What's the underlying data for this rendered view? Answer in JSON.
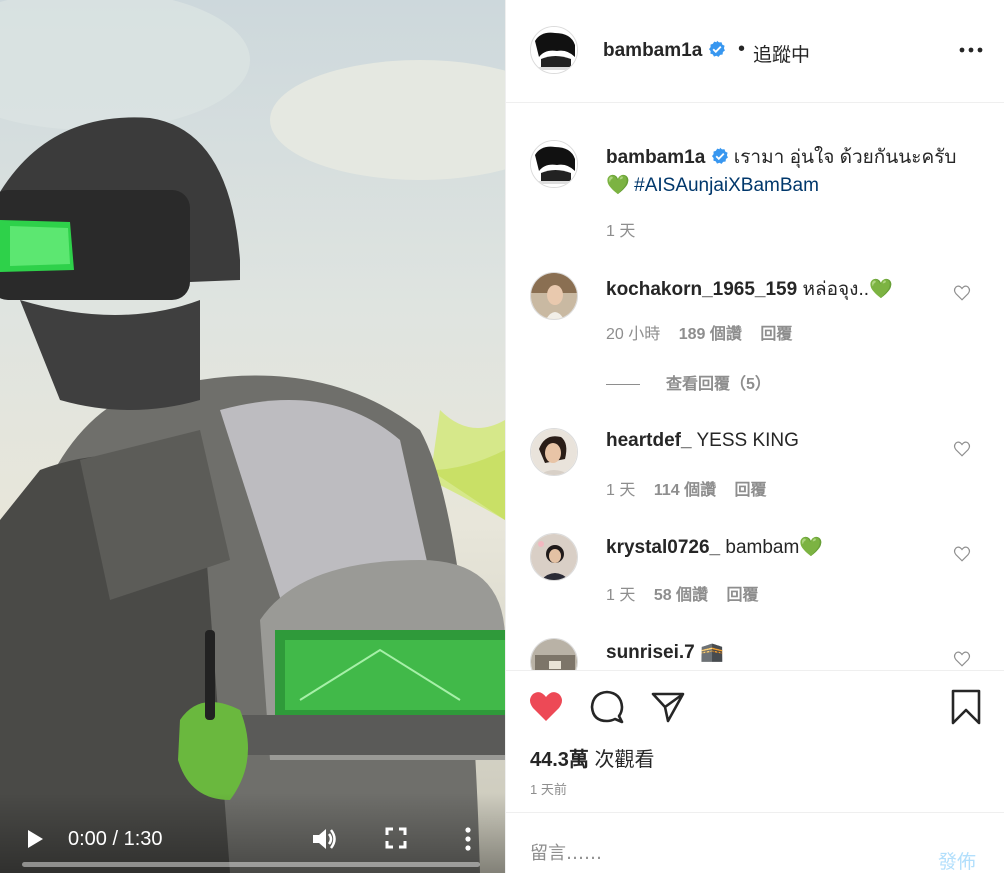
{
  "video": {
    "time_display": "0:00 / 1:30",
    "progress_fraction": 0.0
  },
  "post": {
    "author": "bambam1a",
    "follow_status": "追蹤中",
    "caption_text": "เรามา อุ่นใจ ด้วยกันนะครับ",
    "caption_emoji": "💚",
    "hashtag": "#AISAunjaiXBamBam",
    "caption_time": "1 天",
    "views_count": "44.3萬",
    "views_suffix": "次觀看",
    "posted_ago": "1 天前"
  },
  "comments": [
    {
      "user": "kochakorn_1965_159",
      "text": "หล่อจุง..💚",
      "time": "20 小時",
      "likes": "189 個讚",
      "reply": "回覆",
      "view_replies": "查看回覆（5）"
    },
    {
      "user": "heartdef_",
      "text": "YESS KING",
      "time": "1 天",
      "likes": "114 個讚",
      "reply": "回覆"
    },
    {
      "user": "krystal0726_",
      "text": "bambam💚",
      "time": "1 天",
      "likes": "58 個讚",
      "reply": "回覆"
    },
    {
      "user": "sunrisei.7",
      "text": "🕋",
      "time": "",
      "likes": "",
      "reply": ""
    }
  ],
  "composer": {
    "placeholder": "留言……",
    "post_label": "發佈"
  },
  "colors": {
    "like_red": "#ed4956",
    "link_blue": "#00376b",
    "muted_gray": "#8e8e8e",
    "verified_blue": "#3897f0",
    "post_disabled": "#b2dffc"
  }
}
